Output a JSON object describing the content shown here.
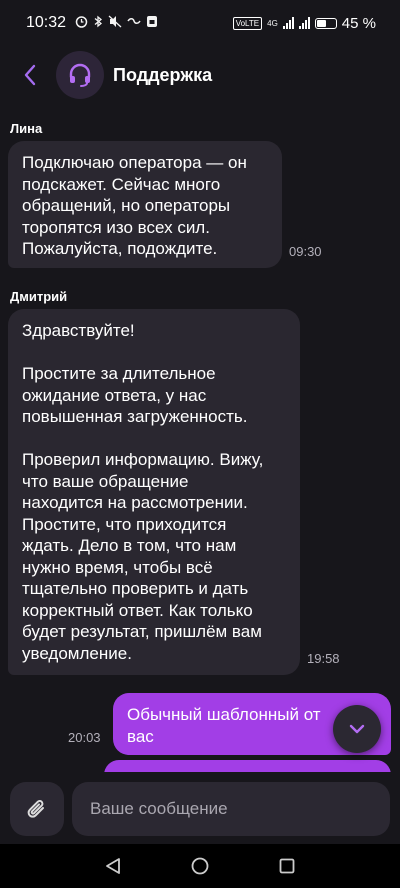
{
  "status_bar": {
    "time": "10:32",
    "battery_percent": "45 %",
    "battery_level": 0.45,
    "network": "4G",
    "volte": "VoLTE",
    "icons": [
      "alarm-icon",
      "bluetooth-icon",
      "mute-icon",
      "tele2-icon",
      "sim-icon",
      "wifi-signal-icon",
      "cell-signal-icon",
      "battery-icon"
    ]
  },
  "header": {
    "title": "Поддержка",
    "avatar_icon": "headset-icon",
    "accent": "#a23ee6"
  },
  "messages": [
    {
      "sender": "Лина",
      "text": "Подключаю оператора — он\nподскажет. Сейчас много\nобращений, но операторы\nторопятся изо всех сил.\nПожалуйста, подождите.",
      "time": "09:30",
      "direction": "incoming"
    },
    {
      "sender": "Дмитрий",
      "text": "Здравствуйте!\n\nПростите за длительное\nожидание ответа, у нас\nповышенная загруженность.\n\nПроверил информацию. Вижу,\nчто ваше обращение\nнаходится на рассмотрении.\nПростите, что приходится\nждать. Дело в том, что нам\nнужно время, чтобы всё\nтщательно проверить и дать\nкорректный ответ. Как только\nбудет результат, пришлём вам\nуведомление.",
      "time": "19:58",
      "direction": "incoming"
    },
    {
      "sender": "",
      "text": "Обычный шаблонный от\nвас",
      "time": "20:03",
      "direction": "outgoing"
    }
  ],
  "composer": {
    "placeholder": "Ваше сообщение",
    "attach_icon": "paperclip-icon"
  },
  "fab_icon": "chevron-down-icon",
  "nav": [
    "back-triangle-icon",
    "home-circle-icon",
    "recents-square-icon"
  ]
}
